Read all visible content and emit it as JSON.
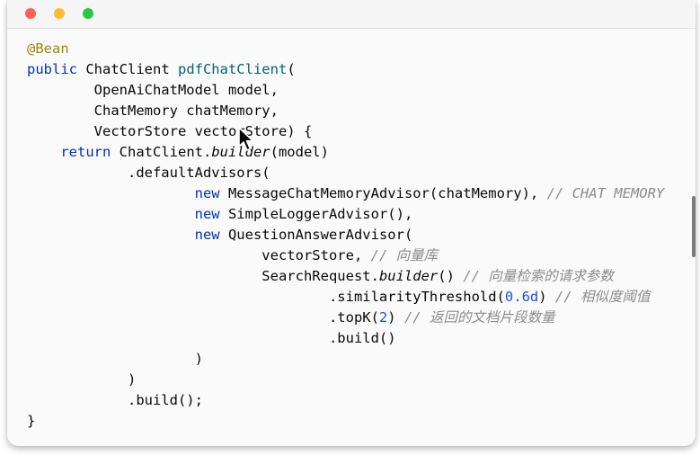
{
  "window": {
    "controls": [
      "close",
      "minimize",
      "zoom"
    ],
    "colors": {
      "close": "#ff5f57",
      "minimize": "#febc2e",
      "zoom": "#28c840"
    }
  },
  "code": {
    "language": "java",
    "lines": [
      [
        {
          "t": "@Bean",
          "c": "annotation"
        }
      ],
      [
        {
          "t": "public",
          "c": "keyword"
        },
        {
          "t": " ChatClient ",
          "c": "plain"
        },
        {
          "t": "pdfChatClient",
          "c": "method-decl"
        },
        {
          "t": "(",
          "c": "plain"
        }
      ],
      [
        {
          "t": "        OpenAiChatModel model,",
          "c": "plain"
        }
      ],
      [
        {
          "t": "        ChatMemory chatMemory,",
          "c": "plain"
        }
      ],
      [
        {
          "t": "        VectorStore vectorStore) {",
          "c": "plain"
        }
      ],
      [
        {
          "t": "    ",
          "c": "plain"
        },
        {
          "t": "return",
          "c": "keyword"
        },
        {
          "t": " ChatClient.",
          "c": "plain"
        },
        {
          "t": "builder",
          "c": "static"
        },
        {
          "t": "(model)",
          "c": "plain"
        }
      ],
      [
        {
          "t": "            .defaultAdvisors(",
          "c": "plain"
        }
      ],
      [
        {
          "t": "                    ",
          "c": "plain"
        },
        {
          "t": "new",
          "c": "keyword"
        },
        {
          "t": " MessageChatMemoryAdvisor(chatMemory), ",
          "c": "plain"
        },
        {
          "t": "// CHAT MEMORY",
          "c": "comment"
        }
      ],
      [
        {
          "t": "                    ",
          "c": "plain"
        },
        {
          "t": "new",
          "c": "keyword"
        },
        {
          "t": " SimpleLoggerAdvisor(),",
          "c": "plain"
        }
      ],
      [
        {
          "t": "                    ",
          "c": "plain"
        },
        {
          "t": "new",
          "c": "keyword"
        },
        {
          "t": " QuestionAnswerAdvisor(",
          "c": "plain"
        }
      ],
      [
        {
          "t": "                            vectorStore, ",
          "c": "plain"
        },
        {
          "t": "// 向量库",
          "c": "comment"
        }
      ],
      [
        {
          "t": "                            SearchRequest.",
          "c": "plain"
        },
        {
          "t": "builder",
          "c": "static"
        },
        {
          "t": "() ",
          "c": "plain"
        },
        {
          "t": "// 向量检索的请求参数",
          "c": "comment"
        }
      ],
      [
        {
          "t": "                                    .similarityThreshold(",
          "c": "plain"
        },
        {
          "t": "0.6d",
          "c": "number"
        },
        {
          "t": ") ",
          "c": "plain"
        },
        {
          "t": "// 相似度阈值",
          "c": "comment"
        }
      ],
      [
        {
          "t": "                                    .topK(",
          "c": "plain"
        },
        {
          "t": "2",
          "c": "number"
        },
        {
          "t": ") ",
          "c": "plain"
        },
        {
          "t": "// 返回的文档片段数量",
          "c": "comment"
        }
      ],
      [
        {
          "t": "                                    .build()",
          "c": "plain"
        }
      ],
      [
        {
          "t": "                    )",
          "c": "plain"
        }
      ],
      [
        {
          "t": "            )",
          "c": "plain"
        }
      ],
      [
        {
          "t": "            .build();",
          "c": "plain"
        }
      ],
      [
        {
          "t": "}",
          "c": "plain"
        }
      ]
    ]
  },
  "icons": {
    "cursor": "mouse-pointer-icon",
    "scrollbar": "vertical-scrollbar"
  }
}
